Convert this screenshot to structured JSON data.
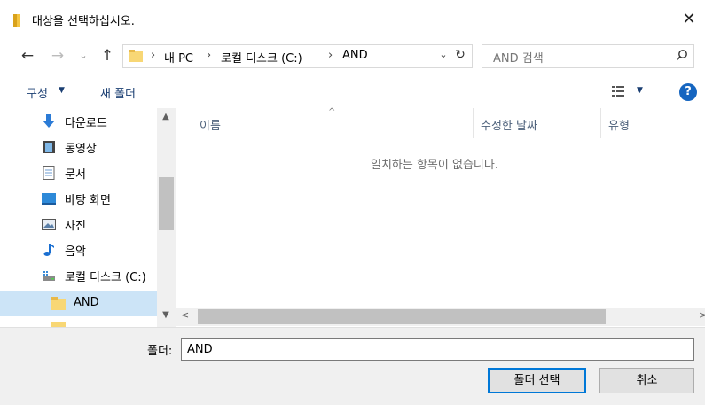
{
  "window": {
    "title": "대상을 선택하십시오.",
    "close_label": "✕"
  },
  "nav": {
    "back_icon": "arrow-left-icon",
    "forward_icon": "arrow-right-icon",
    "recent_icon": "chevron-down-icon",
    "up_icon": "arrow-up-icon"
  },
  "address": {
    "crumbs": [
      "내 PC",
      "로컬 디스크 (C:)",
      "AND"
    ],
    "separator": "›"
  },
  "search": {
    "placeholder": "AND 검색"
  },
  "toolbar": {
    "organize_label": "구성",
    "new_folder_label": "새 폴더",
    "help_label": "?"
  },
  "navpane": {
    "items": [
      {
        "label": "다운로드",
        "icon": "download-icon"
      },
      {
        "label": "동영상",
        "icon": "video-icon"
      },
      {
        "label": "문서",
        "icon": "document-icon"
      },
      {
        "label": "바탕 화면",
        "icon": "desktop-icon"
      },
      {
        "label": "사진",
        "icon": "picture-icon"
      },
      {
        "label": "음악",
        "icon": "music-icon"
      },
      {
        "label": "로컬 디스크 (C:)",
        "icon": "drive-icon"
      },
      {
        "label": "AND",
        "icon": "folder-icon",
        "selected": true
      }
    ]
  },
  "filelist": {
    "columns": [
      "이름",
      "수정한 날짜",
      "유형"
    ],
    "empty_message": "일치하는 항목이 없습니다."
  },
  "footer": {
    "folder_label": "폴더:",
    "folder_value": "AND",
    "select_button": "폴더 선택",
    "cancel_button": "취소"
  },
  "colors": {
    "accent": "#0078d7",
    "selection": "#cce4f7",
    "folder": "#f8d775"
  }
}
